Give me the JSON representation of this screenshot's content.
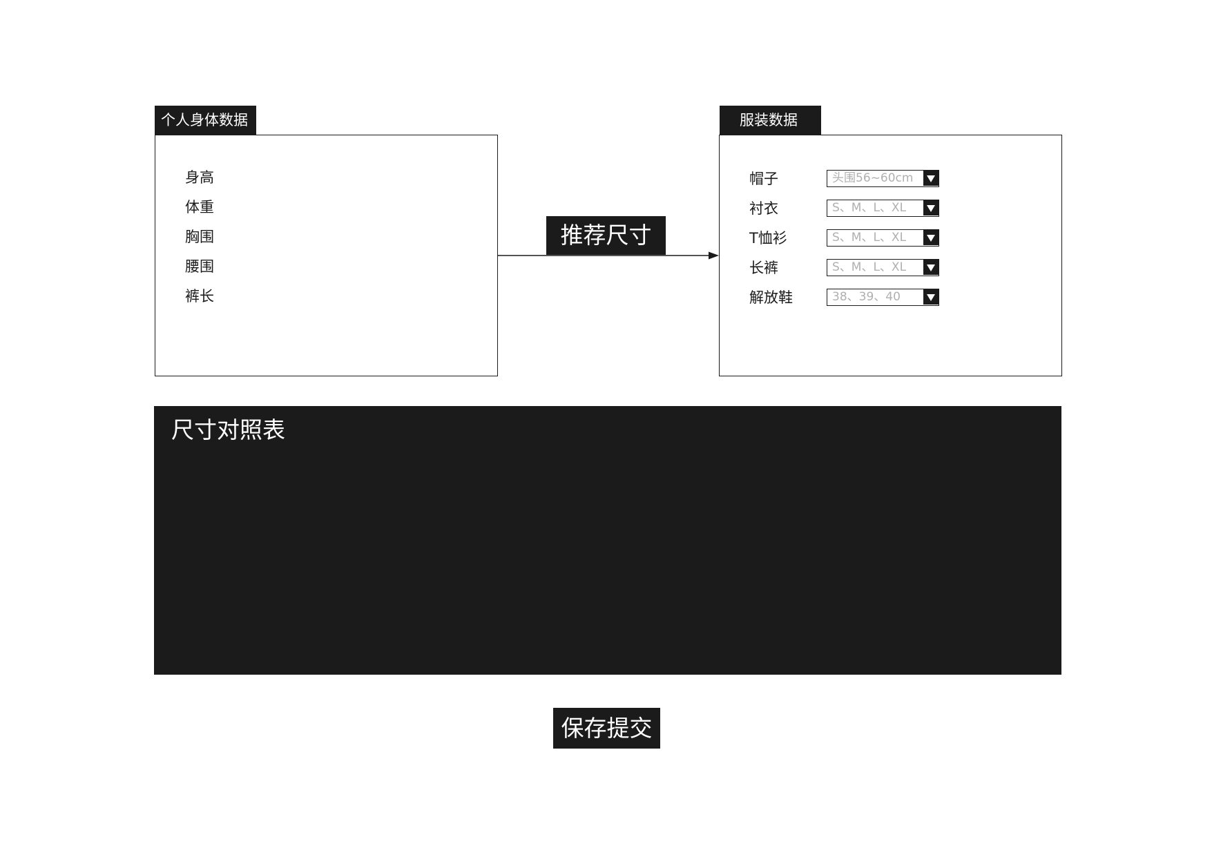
{
  "body_panel": {
    "title": "个人身体数据",
    "fields": [
      "身高",
      "体重",
      "胸围",
      "腰围",
      "裤长"
    ]
  },
  "clothing_panel": {
    "title": "服装数据",
    "fields": [
      {
        "label": "帽子",
        "placeholder": "头围56~60cm"
      },
      {
        "label": "衬衣",
        "placeholder": "S、M、L、XL"
      },
      {
        "label": "T恤衫",
        "placeholder": "S、M、L、XL"
      },
      {
        "label": "长裤",
        "placeholder": "S、M、L、XL"
      },
      {
        "label": "解放鞋",
        "placeholder": "38、39、40"
      }
    ]
  },
  "recommend_button": {
    "label": "推荐尺寸"
  },
  "size_table": {
    "title": "尺寸对照表"
  },
  "submit_button": {
    "label": "保存提交"
  },
  "colors": {
    "dark": "#1b1b1b",
    "background": "#ffffff",
    "placeholder": "#b0b0b0"
  },
  "icons": {
    "dropdown": "triangle-down-icon",
    "connector": "arrow-right-icon"
  }
}
